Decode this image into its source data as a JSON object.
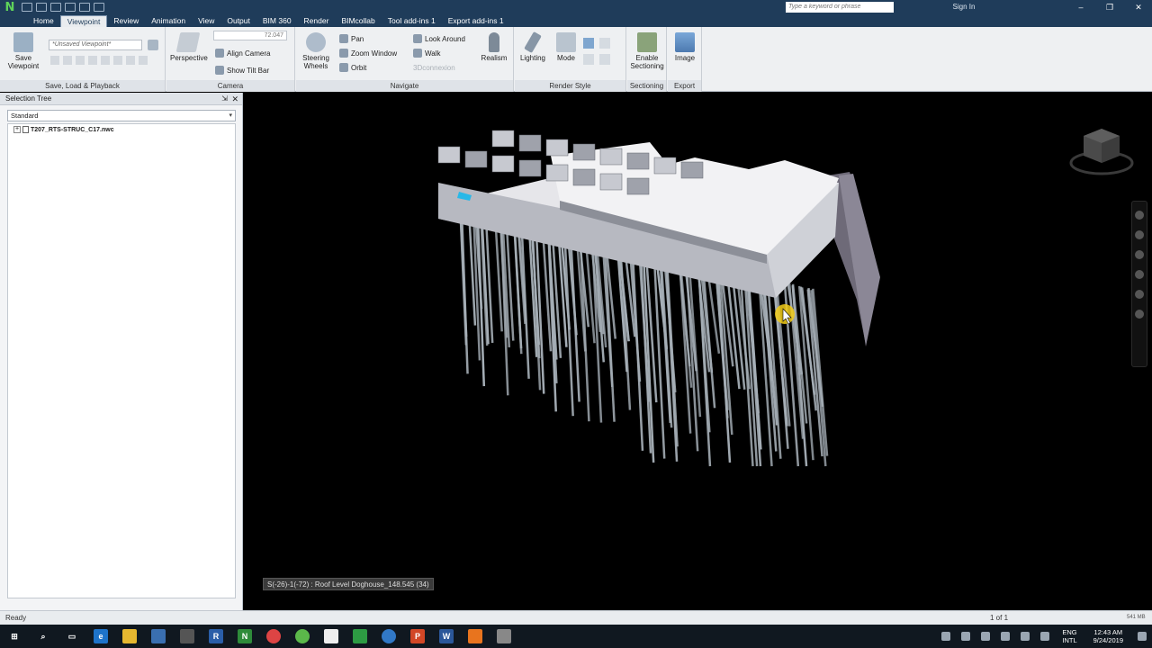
{
  "titlebar": {
    "search_placeholder": "Type a keyword or phrase",
    "sign_in": "Sign In",
    "minimize": "–",
    "maximize": "❐",
    "close": "✕"
  },
  "tabs": [
    "Home",
    "Viewpoint",
    "Review",
    "Animation",
    "View",
    "Output",
    "BIM 360",
    "Render",
    "BIMcollab",
    "Tool add-ins 1",
    "Export add-ins 1"
  ],
  "active_tab": "Viewpoint",
  "ribbon": {
    "save_viewpoint": "Save Viewpoint",
    "viewpoint_dropdown": "*Unsaved Viewpoint*",
    "panel_save_load": "Save, Load & Playback",
    "perspective": "Perspective",
    "fov_value": "72.047",
    "align_camera": "Align Camera",
    "show_tilt_bar": "Show Tilt Bar",
    "panel_camera": "Camera",
    "steering_wheels": "Steering Wheels",
    "pan": "Pan",
    "zoom_window": "Zoom Window",
    "orbit": "Orbit",
    "look_around": "Look Around",
    "walk": "Walk",
    "connexion": "3Dconnexion",
    "realism": "Realism",
    "panel_navigate": "Navigate",
    "lighting": "Lighting",
    "mode": "Mode",
    "panel_render_style": "Render Style",
    "enable_sectioning": "Enable Sectioning",
    "panel_sectioning": "Sectioning",
    "image": "Image",
    "panel_export": "Export"
  },
  "selection_tree": {
    "title": "Selection Tree",
    "pin": "⇲",
    "close": "✕",
    "dropdown_value": "Standard",
    "root_item": "T207_RTS-STRUC_C17.nwc"
  },
  "viewport": {
    "tooltip": "S(-26)-1(-72) : Roof Level Doghouse_148.545 (34)"
  },
  "statusbar": {
    "status": "Ready",
    "page_counter": "1 of 1",
    "memory": "541 MB"
  },
  "taskbar": {
    "lang_line1": "ENG",
    "lang_line2": "INTL",
    "time": "12:43 AM",
    "date": "9/24/2019"
  },
  "colors": {
    "titlebar": "#1f3c5a",
    "ribbon": "#eef0f2",
    "viewport_bg": "#000000",
    "building": "#d8d8dc",
    "piles": "#a7b0b8",
    "highlight": "#f2cc19",
    "selected_element": "#28b8e8"
  }
}
